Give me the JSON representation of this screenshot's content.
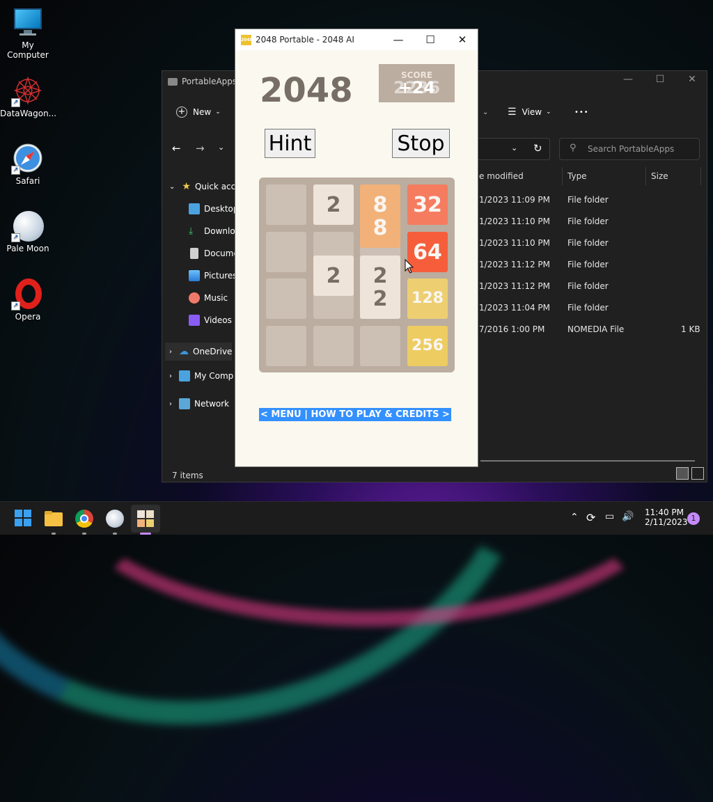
{
  "desktop": {
    "icons": [
      {
        "label": "My Computer"
      },
      {
        "label": "DataWagon..."
      },
      {
        "label": "Safari"
      },
      {
        "label": "Pale Moon"
      },
      {
        "label": "Opera"
      }
    ]
  },
  "explorer": {
    "title": "PortableApps",
    "toolbar": {
      "new_label": "New",
      "view_label": "View",
      "more_label": "•••"
    },
    "search_placeholder": "Search PortableApps",
    "sidebar": [
      {
        "label": "Quick acce"
      },
      {
        "label": "Desktop"
      },
      {
        "label": "Downloa"
      },
      {
        "label": "Docume"
      },
      {
        "label": "Pictures"
      },
      {
        "label": "Music"
      },
      {
        "label": "Videos"
      },
      {
        "label": "OneDrive"
      },
      {
        "label": "My Comp"
      },
      {
        "label": "Network"
      }
    ],
    "columns": {
      "modified": "e modified",
      "type": "Type",
      "size": "Size"
    },
    "rows": [
      {
        "modified": "1/2023 11:09 PM",
        "type": "File folder",
        "size": ""
      },
      {
        "modified": "1/2023 11:10 PM",
        "type": "File folder",
        "size": ""
      },
      {
        "modified": "1/2023 11:10 PM",
        "type": "File folder",
        "size": ""
      },
      {
        "modified": "1/2023 11:12 PM",
        "type": "File folder",
        "size": ""
      },
      {
        "modified": "1/2023 11:12 PM",
        "type": "File folder",
        "size": ""
      },
      {
        "modified": "1/2023 11:04 PM",
        "type": "File folder",
        "size": ""
      },
      {
        "modified": "7/2016 1:00 PM",
        "type": "NOMEDIA File",
        "size": "1 KB"
      }
    ],
    "status": "7 items"
  },
  "game": {
    "window_title": "2048 Portable - 2048 AI",
    "app_icon_text": "2048",
    "heading": "2048",
    "score_label": "SCORE",
    "score_value": "2236",
    "score_delta": "+24",
    "hint_label": "Hint",
    "stop_label": "Stop",
    "menu_link": "< MENU | HOW TO PLAY & CREDITS >",
    "tiles": [
      {
        "text": "2",
        "bg": "#eee4da",
        "fg": "#776e65"
      },
      {
        "text": "8\n8",
        "bg": "#f2b179",
        "fg": "#f9f6f2"
      },
      {
        "text": "32",
        "bg": "#f67c5f",
        "fg": "#f9f6f2"
      },
      {
        "text": "64",
        "bg": "#f65e3b",
        "fg": "#f9f6f2"
      },
      {
        "text": "2",
        "bg": "#eee4da",
        "fg": "#776e65"
      },
      {
        "text": "2\n2",
        "bg": "#eee4da",
        "fg": "#776e65"
      },
      {
        "text": "128",
        "bg": "#edcf72",
        "fg": "#f9f6f2"
      },
      {
        "text": "256",
        "bg": "#edcc61",
        "fg": "#f9f6f2"
      }
    ]
  },
  "taskbar": {
    "time": "11:40 PM",
    "date": "2/11/2023",
    "notification_count": "1"
  }
}
